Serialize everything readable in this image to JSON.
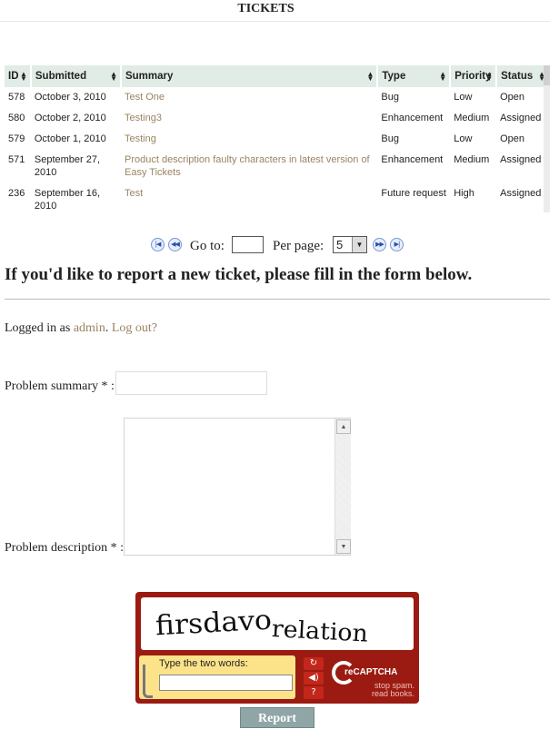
{
  "page": {
    "title": "TICKETS"
  },
  "table": {
    "headers": [
      "ID",
      "Submitted",
      "Summary",
      "Type",
      "Priority",
      "Status"
    ],
    "rows": [
      {
        "id": "578",
        "submitted": "October 3, 2010",
        "summary": "Test One",
        "type": "Bug",
        "priority": "Low",
        "status": "Open"
      },
      {
        "id": "580",
        "submitted": "October 2, 2010",
        "summary": "Testing3",
        "type": "Enhancement",
        "priority": "Medium",
        "status": "Assigned"
      },
      {
        "id": "579",
        "submitted": "October 1, 2010",
        "summary": "Testing",
        "type": "Bug",
        "priority": "Low",
        "status": "Open"
      },
      {
        "id": "571",
        "submitted": "September 27, 2010",
        "summary": "Product description faulty characters in latest version of Easy Tickets",
        "type": "Enhancement",
        "priority": "Medium",
        "status": "Assigned"
      },
      {
        "id": "236",
        "submitted": "September 16, 2010",
        "summary": "Test",
        "type": "Future request",
        "priority": "High",
        "status": "Assigned"
      }
    ]
  },
  "pager": {
    "goto_label": "Go to:",
    "goto_value": "",
    "perpage_label": "Per page:",
    "perpage_value": "5"
  },
  "form": {
    "heading": "If you'd like to report a new ticket, please fill in the form below.",
    "logged_in_prefix": "Logged in as",
    "username": "admin",
    "logout_label": "Log out?",
    "summary_label": "Problem summary * :",
    "description_label": "Problem description * :",
    "summary_value": "",
    "description_value": ""
  },
  "captcha": {
    "word1": "firsdavo",
    "word2": "relation",
    "prompt": "Type the two words:",
    "brand": "reCAPTCHA",
    "tagline_1": "stop spam.",
    "tagline_2": "read books."
  },
  "submit": {
    "label": "Report"
  },
  "icons": [
    "first-page-icon",
    "prev-page-icon",
    "next-page-icon",
    "last-page-icon",
    "refresh-icon",
    "audio-icon",
    "help-icon",
    "sort-icon"
  ],
  "colors": {
    "header_bg": "#e2ece6",
    "link": "#9a8460",
    "captcha_bg": "#9b1b12",
    "captcha_answer": "#fce38a",
    "report_button": "#8fa5a6"
  }
}
